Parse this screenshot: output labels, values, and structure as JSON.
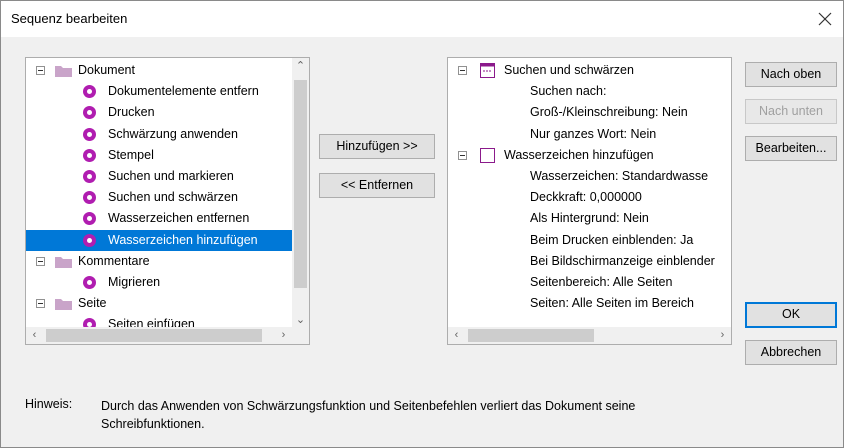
{
  "window": {
    "title": "Sequenz bearbeiten"
  },
  "left_tree": {
    "rows": [
      {
        "label": "Dokument",
        "kind": "group"
      },
      {
        "label": "Dokumentelemente entfern",
        "kind": "action"
      },
      {
        "label": "Drucken",
        "kind": "action"
      },
      {
        "label": "Schwärzung anwenden",
        "kind": "action"
      },
      {
        "label": "Stempel",
        "kind": "action"
      },
      {
        "label": "Suchen und markieren",
        "kind": "action"
      },
      {
        "label": "Suchen und schwärzen",
        "kind": "action"
      },
      {
        "label": "Wasserzeichen entfernen",
        "kind": "action"
      },
      {
        "label": "Wasserzeichen hinzufügen",
        "kind": "action",
        "selected": true
      },
      {
        "label": "Kommentare",
        "kind": "group"
      },
      {
        "label": "Migrieren",
        "kind": "action"
      },
      {
        "label": "Seite",
        "kind": "group"
      },
      {
        "label": "Seiten einfügen",
        "kind": "action"
      }
    ]
  },
  "right_tree": {
    "rows": [
      {
        "label": "Suchen und schwärzen",
        "kind": "step",
        "icon": "search-redact-icon"
      },
      {
        "label": "Suchen nach:",
        "kind": "detail"
      },
      {
        "label": "Groß-/Kleinschreibung: Nein",
        "kind": "detail"
      },
      {
        "label": "Nur ganzes Wort: Nein",
        "kind": "detail"
      },
      {
        "label": "Wasserzeichen hinzufügen",
        "kind": "step",
        "icon": "watermark-icon"
      },
      {
        "label": "Wasserzeichen: Standardwasse",
        "kind": "detail"
      },
      {
        "label": "Deckkraft: 0,000000",
        "kind": "detail"
      },
      {
        "label": "Als Hintergrund: Nein",
        "kind": "detail"
      },
      {
        "label": "Beim Drucken einblenden: Ja",
        "kind": "detail"
      },
      {
        "label": "Bei Bildschirmanzeige einblender",
        "kind": "detail"
      },
      {
        "label": "Seitenbereich: Alle Seiten",
        "kind": "detail"
      },
      {
        "label": "Seiten: Alle Seiten im Bereich",
        "kind": "detail"
      }
    ]
  },
  "buttons": {
    "add": "Hinzufügen >>",
    "remove": "<< Entfernen",
    "move_up": "Nach oben",
    "move_down": "Nach unten",
    "edit": "Bearbeiten...",
    "ok": "OK",
    "cancel": "Abbrechen"
  },
  "hint": {
    "label": "Hinweis:",
    "text": "Durch das Anwenden von Schwärzungsfunktion und Seitenbefehlen verliert das Dokument seine Schreibfunktionen."
  },
  "colors": {
    "selection": "#0078d7",
    "action_icon": "#b01db0",
    "folder": "#c9a4c9"
  }
}
